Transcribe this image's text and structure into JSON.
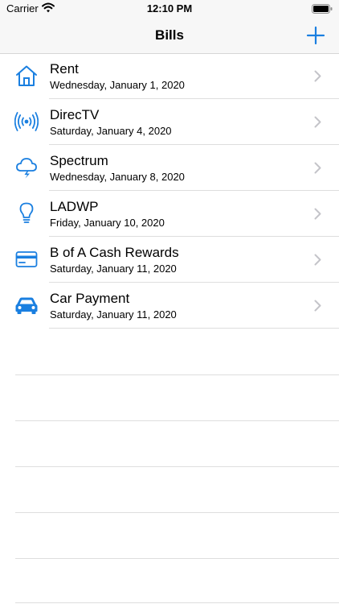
{
  "status_bar": {
    "carrier": "Carrier",
    "time": "12:10 PM"
  },
  "nav": {
    "title": "Bills",
    "add_icon": "plus-icon"
  },
  "colors": {
    "accent": "#1a7fe0",
    "separator": "#dedede",
    "chevron": "#c4c4c9"
  },
  "bills": [
    {
      "name": "Rent",
      "date": "Wednesday, January 1, 2020",
      "icon": "house-icon"
    },
    {
      "name": "DirecTV",
      "date": "Saturday, January 4, 2020",
      "icon": "broadcast-icon"
    },
    {
      "name": "Spectrum",
      "date": "Wednesday, January 8, 2020",
      "icon": "cloud-bolt-icon"
    },
    {
      "name": "LADWP",
      "date": "Friday, January 10, 2020",
      "icon": "lightbulb-icon"
    },
    {
      "name": "B of A Cash Rewards",
      "date": "Saturday, January 11, 2020",
      "icon": "credit-card-icon"
    },
    {
      "name": "Car Payment",
      "date": "Saturday, January 11, 2020",
      "icon": "car-icon"
    }
  ]
}
